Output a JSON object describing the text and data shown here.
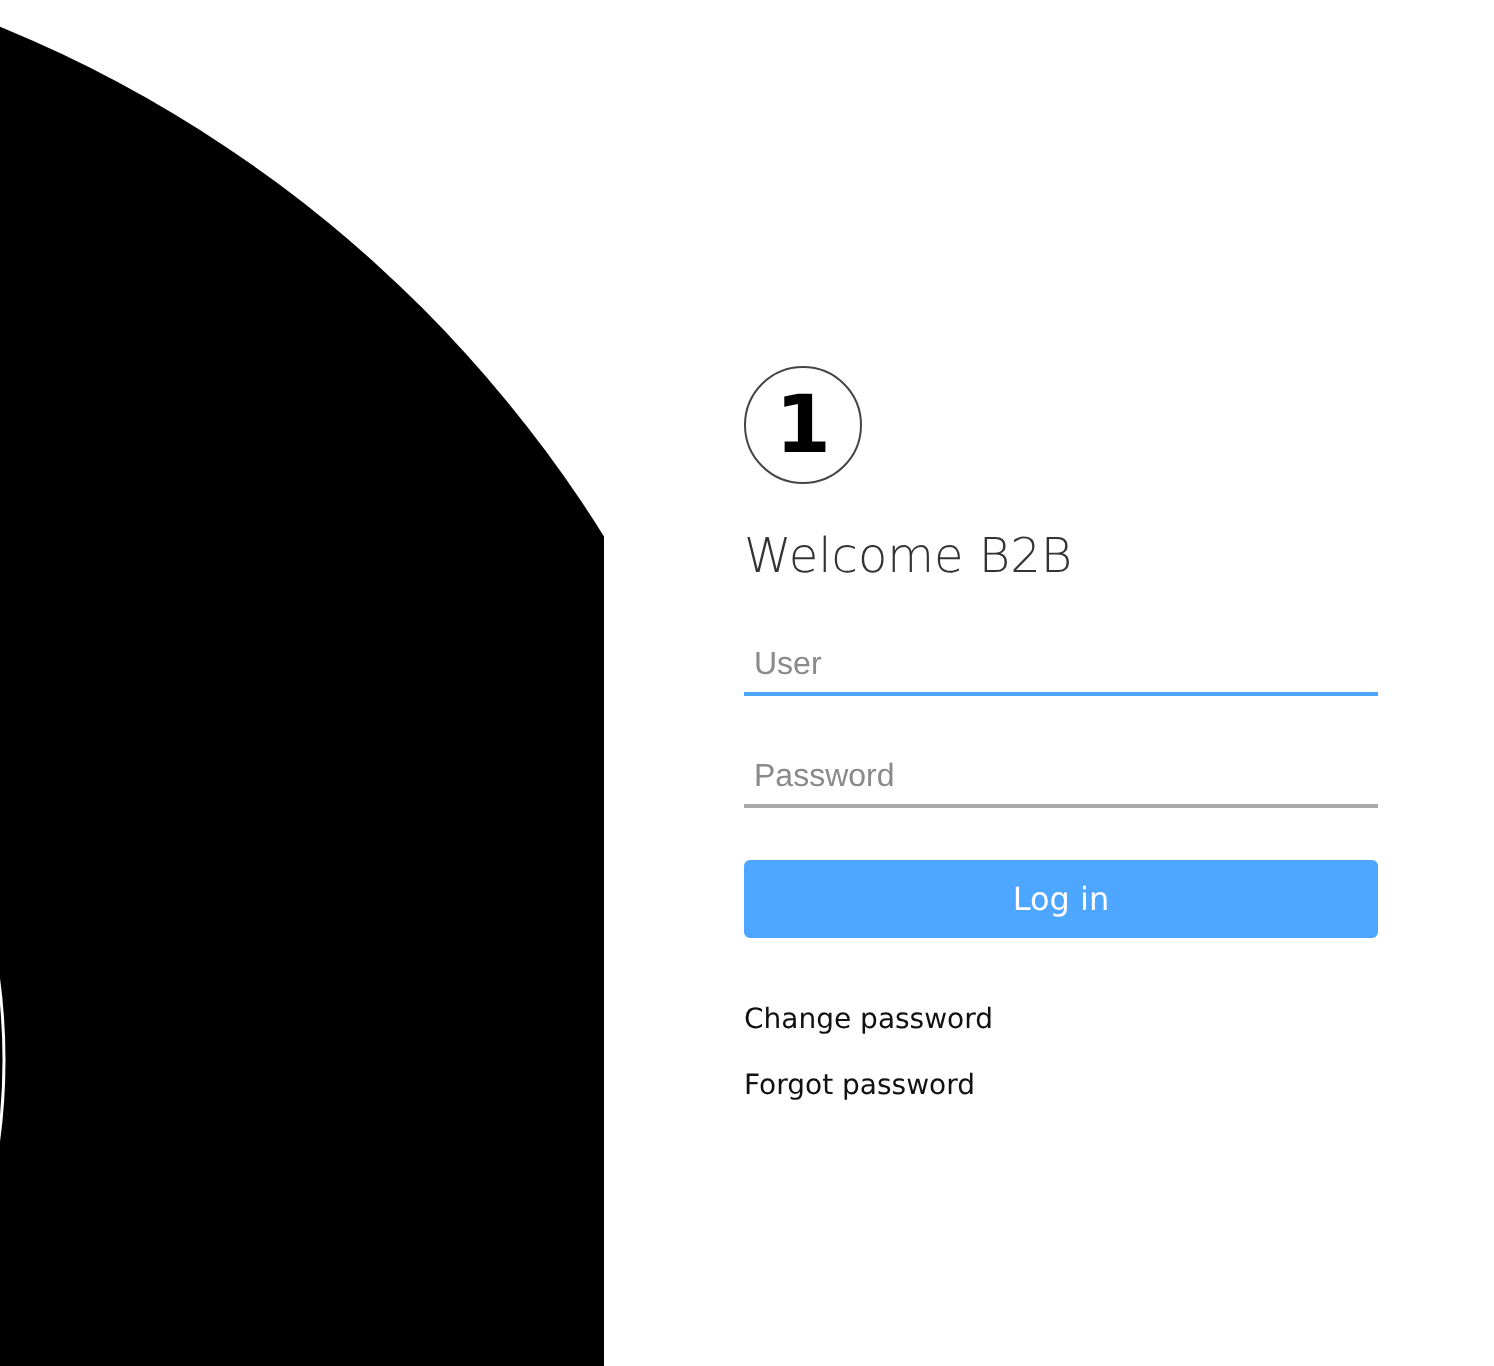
{
  "logo": "1",
  "title": "Welcome B2B",
  "fields": [
    {
      "placeholder": "User",
      "focused": true
    },
    {
      "placeholder": "Password",
      "focused": false
    }
  ],
  "button": "Log in",
  "links": [
    "Change password",
    "Forgot password"
  ]
}
